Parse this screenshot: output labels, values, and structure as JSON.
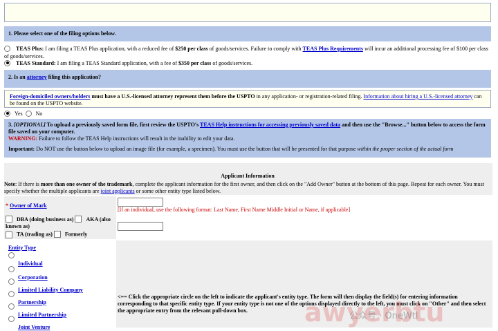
{
  "section1": {
    "title": "1. Please select one of the filing options below.",
    "plus_label": "TEAS Plus:",
    "plus_text_a": "I am filing a TEAS Plus application, with a reduced fee of",
    "plus_fee": "$250 per class",
    "plus_text_b": "of goods/services. Failure to comply with",
    "plus_link": "TEAS Plus Requirements",
    "plus_text_c": "will incur an additional processing fee of $100 per class of goods/services.",
    "standard_label": "TEAS Standard:",
    "standard_text_a": "I am filing a TEAS Standard application, with a fee of",
    "standard_fee": "$350 per class",
    "standard_text_b": "of goods/services."
  },
  "section2": {
    "title_a": "2. Is an",
    "title_link": "attorney",
    "title_b": "filing this application?",
    "foreign_link": "Foreign-domiciled owners/holders",
    "foreign_bold": "must have a U.S.-licensed attorney represent them before the USPTO",
    "foreign_rest": "in any application- or registration-related filing.",
    "info_link": "Information about hiring a U.S.-licensed attorney",
    "info_rest": "can be found on the USPTO website.",
    "yes": "Yes",
    "no": "No"
  },
  "section3": {
    "num": "3.",
    "optional": "[OPTIONAL]",
    "text_a": "To upload a previously saved form file, first review the USPTO's",
    "help_link": "TEAS Help instructions for accessing previously saved data",
    "text_b": "and then use the \"Browse...\" button below to access the form file saved on your computer.",
    "warning_label": "WARNING:",
    "warning_text": "Failure to follow the TEAS Help instructions will result in the inability to edit your data.",
    "important_label": "Important:",
    "important_text": "Do NOT use the button below to upload an image file (for example, a specimen). You must use the button that will be presented for that purpose",
    "important_italic": "within the proper section of the actual form"
  },
  "applicant": {
    "heading": "Applicant Information",
    "note_label": "Note",
    "note_a": ": If there is",
    "note_bold": "more than one owner of the trademark",
    "note_b": ", complete the applicant information for the first owner, and then click on the \"Add Owner\" button at the bottom of this page. Repeat for each owner. You must specify whether the multiple applicants are",
    "joint_link": "joint applicants",
    "note_c": "or some other entity type listed below.",
    "required_mark": "*",
    "owner_label": "Owner of Mark",
    "owner_hint": "[If an individual, use the following format: Last Name, First Name Middle Initial or Name, if applicable]",
    "dba": "DBA (doing business as)",
    "aka": "AKA (also known as)",
    "ta": "TA (trading as)",
    "formerly": "Formerly",
    "entity_type": "Entity Type",
    "entities": [
      "Individual",
      "Corporation",
      "Limited Liability Company",
      "Partnership",
      "Limited Partnership",
      "Joint Venture"
    ],
    "entity_instructions": "<== Click the appropriate circle on the left to indicate the applicant's entity type. The form will then display the field(s) for entering information corresponding to that specific entity type. If your entity type is not one of the options displayed directly to the left, you must click on \"Other\" and then select the appropriate entry from the relevant pull-down box."
  },
  "watermark": {
    "text_a": "awyerbtu",
    "text_b": "公众号 · OneWtl"
  }
}
